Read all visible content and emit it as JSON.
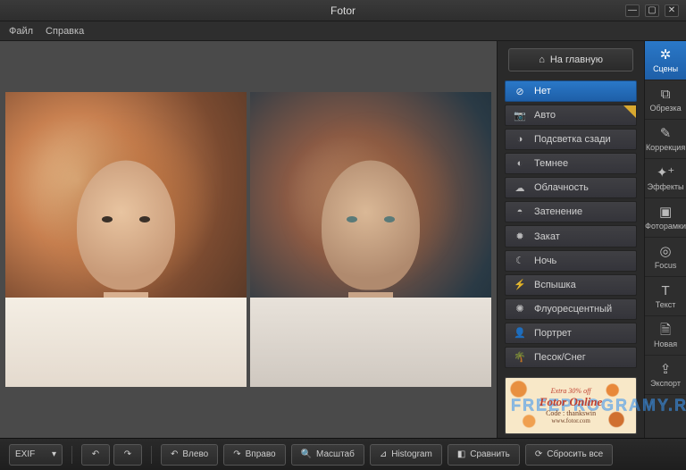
{
  "app": {
    "title": "Fotor"
  },
  "menu": {
    "file": "Файл",
    "help": "Справка"
  },
  "window": {
    "min": "—",
    "max": "▢",
    "close": "✕"
  },
  "header": {
    "home_label": "На главную",
    "home_icon": "⌂"
  },
  "scenes": [
    {
      "icon": "⊘",
      "label": "Нет",
      "active": true,
      "flag": false
    },
    {
      "icon": "📷",
      "label": "Авто",
      "active": false,
      "flag": true
    },
    {
      "icon": "◑",
      "label": "Подсветка сзади",
      "active": false,
      "flag": false
    },
    {
      "icon": "◐",
      "label": "Темнее",
      "active": false,
      "flag": false
    },
    {
      "icon": "☁",
      "label": "Облачность",
      "active": false,
      "flag": false
    },
    {
      "icon": "◓",
      "label": "Затенение",
      "active": false,
      "flag": false
    },
    {
      "icon": "✹",
      "label": "Закат",
      "active": false,
      "flag": false
    },
    {
      "icon": "☾",
      "label": "Ночь",
      "active": false,
      "flag": false
    },
    {
      "icon": "⚡",
      "label": "Вспышка",
      "active": false,
      "flag": false
    },
    {
      "icon": "✺",
      "label": "Флуоресцентный",
      "active": false,
      "flag": false
    },
    {
      "icon": "👤",
      "label": "Портрет",
      "active": false,
      "flag": false
    },
    {
      "icon": "🌴",
      "label": "Песок/Снег",
      "active": false,
      "flag": false
    }
  ],
  "tools": [
    {
      "icon": "✲",
      "label": "Сцены",
      "active": true
    },
    {
      "icon": "⧉",
      "label": "Обрезка",
      "active": false
    },
    {
      "icon": "✎",
      "label": "Коррекция",
      "active": false
    },
    {
      "icon": "✦⁺",
      "label": "Эффекты",
      "active": false
    },
    {
      "icon": "▣",
      "label": "Фоторамки",
      "active": false
    },
    {
      "icon": "◎",
      "label": "Focus",
      "active": false
    },
    {
      "icon": "T",
      "label": "Текст",
      "active": false
    },
    {
      "icon": "🗎",
      "label": "Новая",
      "active": false
    },
    {
      "icon": "⇪",
      "label": "Экспорт",
      "active": false
    }
  ],
  "ad": {
    "watermark": "FREEPROGRAMY.RU",
    "extra": "Extra 30% off",
    "main": "Fotor Online",
    "code": "Code : thankswin",
    "url": "www.fotor.com"
  },
  "bottom": {
    "exif_label": "EXIF",
    "exif_arrow": "▾",
    "undo_icon": "↶",
    "redo_icon": "↷",
    "left": {
      "icon": "↶",
      "label": "Влево"
    },
    "right": {
      "icon": "↷",
      "label": "Вправо"
    },
    "zoom": {
      "icon": "🔍",
      "label": "Масштаб"
    },
    "hist": {
      "icon": "⊿",
      "label": "Histogram"
    },
    "compare": {
      "icon": "◧",
      "label": "Сравнить"
    },
    "reset": {
      "icon": "⟳",
      "label": "Сбросить все"
    }
  }
}
